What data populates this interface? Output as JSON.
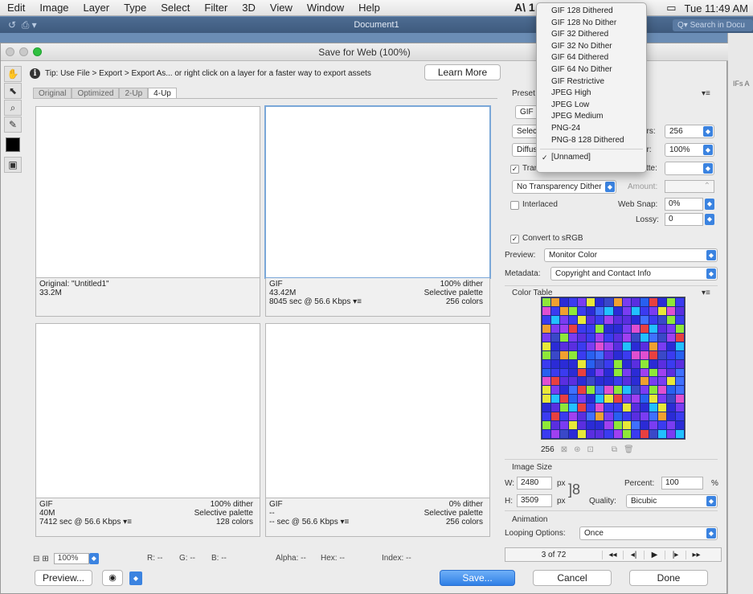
{
  "menubar": {
    "items": [
      "Edit",
      "Image",
      "Layer",
      "Type",
      "Select",
      "Filter",
      "3D",
      "View",
      "Window",
      "Help"
    ],
    "clock": "Tue 11:49 AM",
    "app_glyph": "A\\ 1"
  },
  "app": {
    "document_title": "Document1",
    "search_placeholder": "Q▾ Search in Docu",
    "side_panel_text": "IFs  A"
  },
  "dialog": {
    "title": "Save for Web (100%)",
    "tip": "Tip: Use File > Export > Export As...  or right click on a layer for a faster way to export assets",
    "learn_more": "Learn More",
    "tabs": [
      "Original",
      "Optimized",
      "2-Up",
      "4-Up"
    ],
    "active_tab": "4-Up",
    "panes": [
      {
        "left1": "Original: \"Untitled1\"",
        "left2": "33.2M",
        "left3": "",
        "right1": "",
        "right2": "",
        "right3": ""
      },
      {
        "left1": "GIF",
        "left2": "43.42M",
        "left3": "8045 sec @ 56.6 Kbps  ▾≡",
        "right1": "100% dither",
        "right2": "Selective palette",
        "right3": "256 colors"
      },
      {
        "left1": "GIF",
        "left2": "40M",
        "left3": "7412 sec @ 56.6 Kbps  ▾≡",
        "right1": "100% dither",
        "right2": "Selective palette",
        "right3": "128 colors"
      },
      {
        "left1": "GIF",
        "left2": "--",
        "left3": "-- sec @ 56.6 Kbps  ▾≡",
        "right1": "0% dither",
        "right2": "Selective palette",
        "right3": "256 colors"
      }
    ],
    "status": {
      "zoom": "100%",
      "r": "R: --",
      "g": "G: --",
      "b": "B: --",
      "alpha": "Alpha: --",
      "hex": "Hex: --",
      "index": "Index: --"
    },
    "buttons": {
      "preview": "Preview...",
      "save": "Save...",
      "cancel": "Cancel",
      "done": "Done"
    }
  },
  "settings": {
    "preset_label": "Preset",
    "format_value": "GIF",
    "reduction_value": "Selec",
    "colors_label": "ors:",
    "colors_value": "256",
    "dither_algo_value": "Diffus",
    "dither_label": "er:",
    "dither_value": "100%",
    "transparency_label": "Tran",
    "matte_label": "tte:",
    "transparency_dither_value": "No Transparency Dither",
    "amount_label": "Amount:",
    "interlaced_label": "Interlaced",
    "web_snap_label": "Web Snap:",
    "web_snap_value": "0%",
    "lossy_label": "Lossy:",
    "lossy_value": "0",
    "convert_srgb_label": "Convert to sRGB",
    "preview_label": "Preview:",
    "preview_value": "Monitor Color",
    "metadata_label": "Metadata:",
    "metadata_value": "Copyright and Contact Info",
    "color_table_label": "Color Table",
    "color_count": "256",
    "image_size_label": "Image Size",
    "w_label": "W:",
    "w_value": "2480",
    "h_label": "H:",
    "h_value": "3509",
    "px": "px",
    "percent_label": "Percent:",
    "percent_value": "100",
    "percent_unit": "%",
    "quality_label": "Quality:",
    "quality_value": "Bicubic",
    "animation_label": "Animation",
    "looping_label": "Looping Options:",
    "looping_value": "Once",
    "frame_counter": "3 of 72"
  },
  "preset_menu": {
    "items": [
      "GIF 128 Dithered",
      "GIF 128 No Dither",
      "GIF 32 Dithered",
      "GIF 32 No Dither",
      "GIF 64 Dithered",
      "GIF 64 No Dither",
      "GIF Restrictive",
      "JPEG High",
      "JPEG Low",
      "JPEG Medium",
      "PNG-24",
      "PNG-8 128 Dithered"
    ],
    "checked_item": "[Unnamed]"
  },
  "colors": {
    "accent": "#3b83e0",
    "selected_pane_border": "#7aa7d8",
    "color_table_bg": "#1d2a8c"
  }
}
